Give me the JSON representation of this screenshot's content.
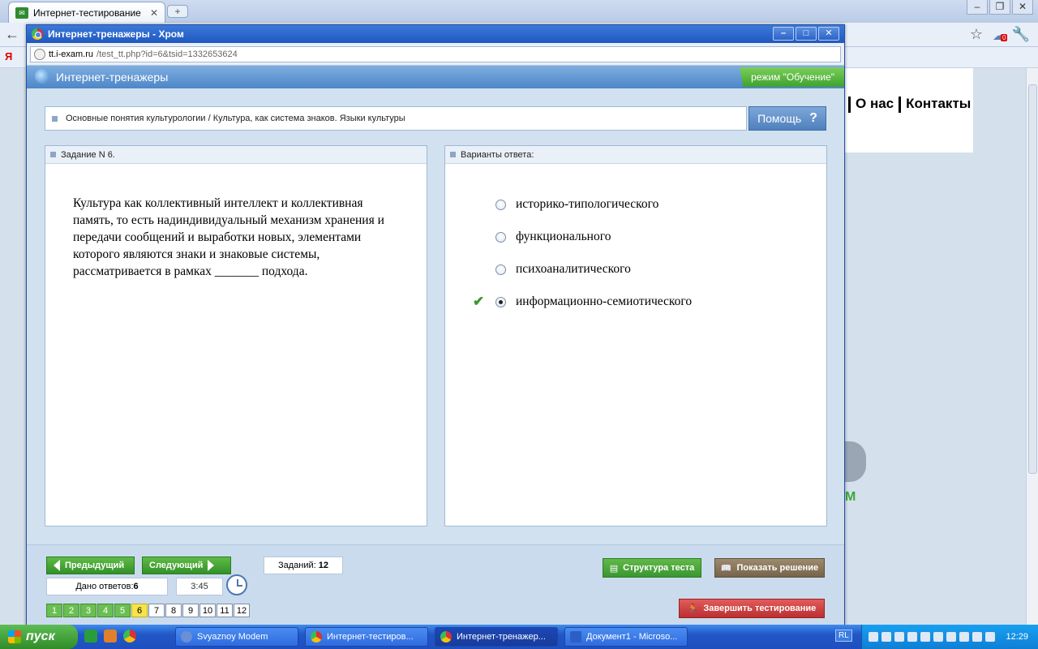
{
  "outer_browser": {
    "tab_title": "Интернет-тестирование",
    "tab_close": "✕",
    "new_tab": "+",
    "bookmark_icon_text": "Я",
    "badge_count": "0"
  },
  "background_page": {
    "nav": [
      "О нас",
      "Контакты"
    ],
    "logo_fragment": "М"
  },
  "popup": {
    "window_title": "Интернет-тренажеры - Хром",
    "url_host": "tt.i-exam.ru",
    "url_path": "/test_tt.php?id=6&tsid=1332653624"
  },
  "app": {
    "header_title": "Интернет-тренажеры",
    "mode": "режим \"Обучение\"",
    "breadcrumb": "Основные понятия культурологии / Культура, как система знаков. Языки культуры",
    "help_label": "Помощь",
    "help_icon": "?",
    "task_header": "Задание N 6.",
    "question": "Культура как коллективный интеллект и коллективная память, то есть надиндивидуальный механизм хранения и передачи сообщений и выработки новых, элементами которого являются знаки и знаковые системы, рассматривается в рамках _______ подхода.",
    "answers_header": "Варианты ответа:",
    "answers": [
      {
        "text": "историко-типологического",
        "selected": false
      },
      {
        "text": "функционального",
        "selected": false
      },
      {
        "text": "психоаналитического",
        "selected": false
      },
      {
        "text": "информационно-семиотического",
        "selected": true
      }
    ],
    "check_mark": "✔",
    "prev_label": "Предыдущий",
    "next_label": "Следующий",
    "tasks_label": "Заданий:",
    "tasks_count": "12",
    "answered_label": "Дано ответов:",
    "answered_count": "6",
    "timer": "3:45",
    "structure_label": "Структура теста",
    "solution_label": "Показать решение",
    "finish_label": "Завершить тестирование",
    "pages": [
      "1",
      "2",
      "3",
      "4",
      "5",
      "6",
      "7",
      "8",
      "9",
      "10",
      "11",
      "12"
    ],
    "done_pages": 5,
    "current_page": "6"
  },
  "taskbar": {
    "start_label": "пуск",
    "tasks": [
      "Svyaznoy Modem",
      "Интернет-тестиров...",
      "Интернет-тренажер...",
      "Документ1 - Microso..."
    ],
    "lang": "RL",
    "time": "12:29"
  },
  "colors": {
    "accent_green": "#3fa22e",
    "header_blue": "#4d86c8",
    "finish_red": "#bb2f2f",
    "current_page": "#f7e34a"
  }
}
